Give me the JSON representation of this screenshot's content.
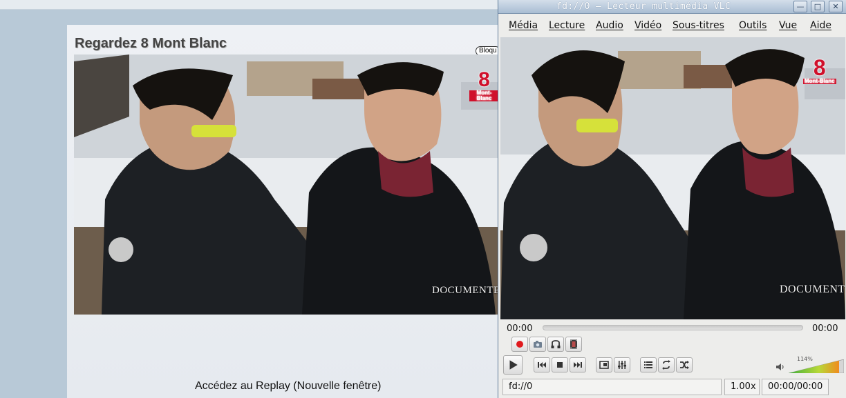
{
  "browser_page": {
    "title": "Regardez 8 Mont Blanc",
    "block_badge": "Bloqu",
    "replay_link": "Accédez au Replay (Nouvelle fenêtre)"
  },
  "video_overlay": {
    "channel_number": "8",
    "channel_name": "Mont-Blanc",
    "watermark": "DOCUMENTERRE"
  },
  "vlc": {
    "window_title": "fd://0 – Lecteur multimédia VLC",
    "window_buttons": [
      "minimize-icon",
      "maximize-icon",
      "close-icon"
    ],
    "menu": [
      "Média",
      "Lecture",
      "Audio",
      "Vidéo",
      "Sous-titres",
      "Outils",
      "Vue",
      "Aide"
    ],
    "time_elapsed": "00:00",
    "time_total": "00:00",
    "seek_progress": 0,
    "advanced_buttons": [
      "record-icon",
      "snapshot-icon",
      "loop-ab-icon",
      "frame-step-icon"
    ],
    "transport_buttons": [
      "play-icon",
      "previous-icon",
      "stop-icon",
      "next-icon"
    ],
    "view_buttons": [
      "fullscreen-icon",
      "extended-settings-icon"
    ],
    "playlist_buttons": [
      "playlist-icon",
      "loop-icon",
      "shuffle-icon"
    ],
    "volume_label": "114%",
    "volume_level": 1.14,
    "status_source": "fd://0",
    "status_speed": "1.00x",
    "status_time": "00:00/00:00",
    "colors": {
      "record": "#e0191d",
      "volume_low": "#3fae3a",
      "volume_high": "#f08c1e"
    }
  }
}
